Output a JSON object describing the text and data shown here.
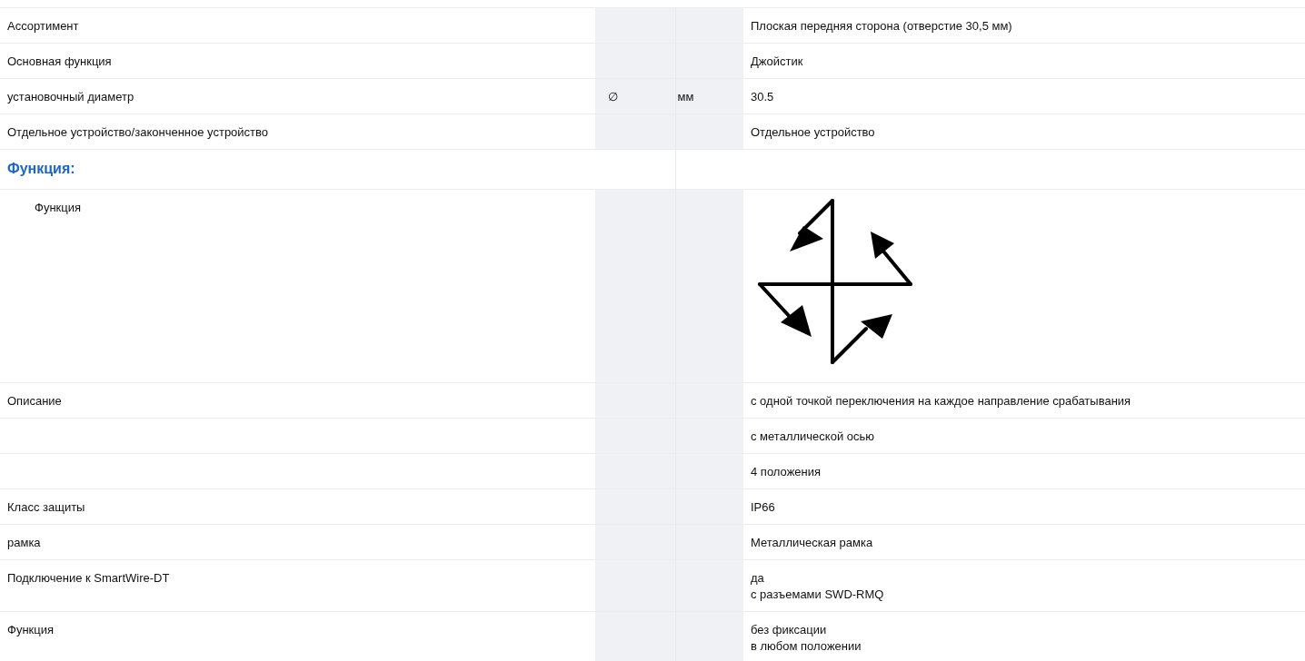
{
  "rows": [
    {
      "kind": "row",
      "label": "Ассортимент",
      "symbol": "",
      "unit": "",
      "values": [
        "Плоская передняя сторона (отверстие 30,5 мм)"
      ]
    },
    {
      "kind": "row",
      "label": "Основная функция",
      "symbol": "",
      "unit": "",
      "values": [
        "Джойстик"
      ]
    },
    {
      "kind": "row",
      "label": "установочный диаметр",
      "symbol": "∅",
      "unit": "мм",
      "values": [
        "30.5"
      ]
    },
    {
      "kind": "row",
      "label": "Отдельное устройство/законченное устройство",
      "symbol": "",
      "unit": "",
      "values": [
        "Отдельное устройство"
      ]
    },
    {
      "kind": "heading",
      "label": "Функция:",
      "symbol": "",
      "unit": "",
      "values": []
    },
    {
      "kind": "image",
      "label": "Функция",
      "symbol": "",
      "unit": "",
      "values": []
    },
    {
      "kind": "row",
      "label": "Описание",
      "symbol": "",
      "unit": "",
      "values": [
        "с одной точкой переключения на каждое направление срабатывания"
      ]
    },
    {
      "kind": "row",
      "label": "",
      "symbol": "",
      "unit": "",
      "values": [
        "с металлической осью"
      ]
    },
    {
      "kind": "row",
      "label": "",
      "symbol": "",
      "unit": "",
      "values": [
        "4 положения"
      ]
    },
    {
      "kind": "row",
      "label": "Класс защиты",
      "symbol": "",
      "unit": "",
      "values": [
        "IP66"
      ]
    },
    {
      "kind": "row",
      "label": "рамка",
      "symbol": "",
      "unit": "",
      "values": [
        "Металлическая рамка"
      ]
    },
    {
      "kind": "row",
      "label": "Подключение к SmartWire-DT",
      "symbol": "",
      "unit": "",
      "values": [
        "да",
        "с разъемами SWD-RMQ"
      ]
    },
    {
      "kind": "row",
      "label": "Функция",
      "symbol": "",
      "unit": "",
      "values": [
        "без фиксации",
        "в любом положении"
      ]
    }
  ]
}
